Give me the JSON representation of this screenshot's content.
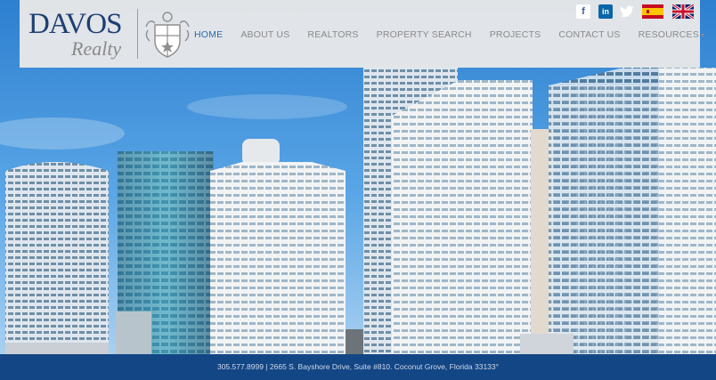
{
  "brand": {
    "name": "DAVOS",
    "sub": "Realty"
  },
  "nav": [
    {
      "label": "HOME",
      "active": true
    },
    {
      "label": "ABOUT US",
      "active": false
    },
    {
      "label": "REALTORS",
      "active": false
    },
    {
      "label": "PROPERTY SEARCH",
      "active": false
    },
    {
      "label": "PROJECTS",
      "active": false
    },
    {
      "label": "CONTACT US",
      "active": false
    },
    {
      "label": "RESOURCES",
      "active": false,
      "dropdown": true
    }
  ],
  "social": {
    "facebook": "f",
    "linkedin": "in",
    "twitter": "t"
  },
  "languages": [
    "Spanish",
    "English"
  ],
  "footer": {
    "text": "305.577.8999 | 2665 S. Bayshore Drive, Suite #810. Coconut Grove, Florida 33133°"
  },
  "colors": {
    "brand_blue": "#1d3f73",
    "footer_blue": "#134685",
    "nav_active": "#2a6cb0"
  }
}
